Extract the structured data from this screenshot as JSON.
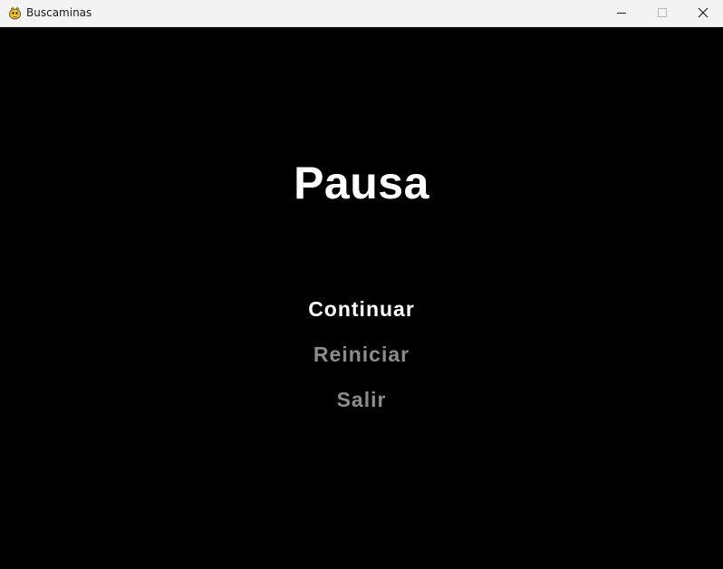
{
  "window": {
    "title": "Buscaminas",
    "icon": "pygame-snake-icon",
    "controls": {
      "minimize": "minimize-icon",
      "maximize": "maximize-icon",
      "close": "close-icon"
    }
  },
  "pause_menu": {
    "title": "Pausa",
    "items": [
      {
        "label": "Continuar",
        "selected": true
      },
      {
        "label": "Reiniciar",
        "selected": false
      },
      {
        "label": "Salir",
        "selected": false
      }
    ]
  },
  "colors": {
    "background": "#000000",
    "selected": "#ffffff",
    "unselected": "#8c8c8c",
    "titlebar": "#f3f3f3"
  }
}
